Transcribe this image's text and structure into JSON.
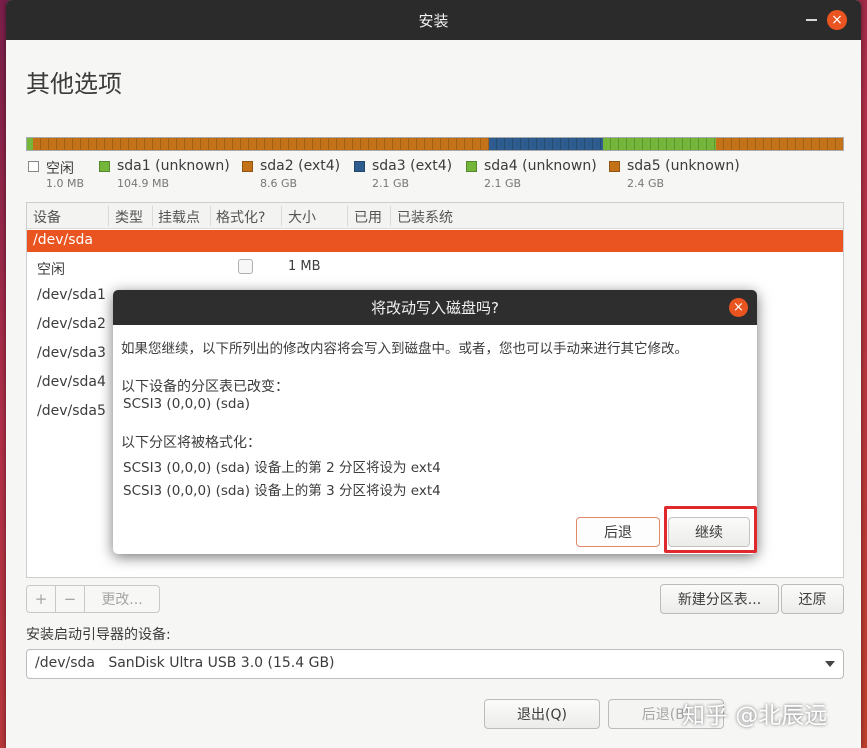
{
  "window": {
    "title": "安装",
    "close_glyph": "×"
  },
  "page": {
    "title": "其他选项"
  },
  "colors": {
    "accent": "#e95420",
    "free": "#ffffff",
    "sda1": "#73b63a",
    "sda2": "#c4721a",
    "sda3": "#2f5c8e",
    "sda4": "#73b63a",
    "sda5": "#c4721a"
  },
  "legend": [
    {
      "name": "空闲",
      "size": "1.0 MB",
      "color": "#ffffff"
    },
    {
      "name": "sda1 (unknown)",
      "size": "104.9 MB",
      "color": "#73b63a"
    },
    {
      "name": "sda2 (ext4)",
      "size": "8.6 GB",
      "color": "#c4721a"
    },
    {
      "name": "sda3 (ext4)",
      "size": "2.1 GB",
      "color": "#2f5c8e"
    },
    {
      "name": "sda4 (unknown)",
      "size": "2.1 GB",
      "color": "#73b63a"
    },
    {
      "name": "sda5 (unknown)",
      "size": "2.4 GB",
      "color": "#c4721a"
    }
  ],
  "table": {
    "headers": [
      "设备",
      "类型",
      "挂载点",
      "格式化?",
      "大小",
      "已用",
      "已装系统"
    ],
    "selected_row": "/dev/sda",
    "rows": [
      {
        "device": "空闲",
        "size": "1 MB"
      },
      {
        "device": "/dev/sda1"
      },
      {
        "device": "/dev/sda2"
      },
      {
        "device": "/dev/sda3"
      },
      {
        "device": "/dev/sda4"
      },
      {
        "device": "/dev/sda5"
      }
    ]
  },
  "controls": {
    "add": "+",
    "remove": "−",
    "change": "更改...",
    "new_table": "新建分区表...",
    "revert": "还原"
  },
  "bootloader": {
    "label": "安装启动引导器的设备:",
    "device": "/dev/sda",
    "description": "SanDisk Ultra USB 3.0 (15.4 GB)"
  },
  "footer": {
    "quit": "退出(Q)",
    "back": "后退(B)"
  },
  "dialog": {
    "title": "将改动写入磁盘吗?",
    "close_glyph": "×",
    "intro": "如果您继续，以下所列出的修改内容将会写入到磁盘中。或者，您也可以手动来进行其它修改。",
    "table_changed_heading": "以下设备的分区表已改变：",
    "table_changed_device": "SCSI3 (0,0,0) (sda)",
    "format_heading": "以下分区将被格式化：",
    "format_lines": [
      "SCSI3 (0,0,0) (sda) 设备上的第 2 分区将设为 ext4",
      "SCSI3 (0,0,0) (sda) 设备上的第 3 分区将设为 ext4"
    ],
    "back_button": "后退",
    "continue_button": "继续"
  },
  "watermark": "知乎 @北辰远"
}
